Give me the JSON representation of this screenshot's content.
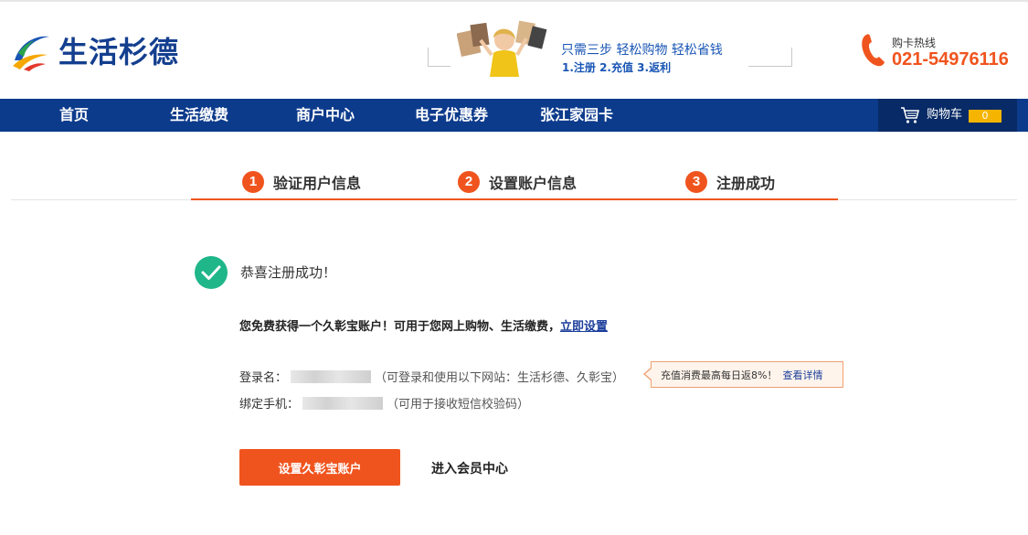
{
  "brand": {
    "name": "生活杉德",
    "colors": {
      "primary_blue": "#0d3b8c",
      "accent_orange": "#f0541e",
      "success_green": "#1fb68a",
      "cart_badge": "#f5b400"
    }
  },
  "promo": {
    "line1": "只需三步  轻松购物  轻松省钱",
    "line2": "1.注册  2.充值  3.返利"
  },
  "hotline": {
    "label": "购卡热线",
    "number": "021-54976116"
  },
  "nav": {
    "items": [
      {
        "label": "首页"
      },
      {
        "label": "生活缴费"
      },
      {
        "label": "商户中心"
      },
      {
        "label": "电子优惠券"
      },
      {
        "label": "张江家园卡"
      }
    ],
    "cart": {
      "label": "购物车",
      "count": "0",
      "icon": "cart-icon"
    }
  },
  "steps": [
    {
      "num": "1",
      "label": "验证用户信息"
    },
    {
      "num": "2",
      "label": "设置账户信息"
    },
    {
      "num": "3",
      "label": "注册成功"
    }
  ],
  "success": {
    "icon": "check-circle-icon",
    "title": "恭喜注册成功！",
    "gift_text": "您免费获得一个久彰宝账户！可用于您网上购物、生活缴费，",
    "gift_link": "立即设置"
  },
  "account": {
    "login_label": "登录名：",
    "login_note": "（可登录和使用以下网站：生活杉德、久彰宝）",
    "phone_label": "绑定手机：",
    "phone_note": "（可用于接收短信校验码）"
  },
  "tip": {
    "text": "充值消费最高每日返8%！",
    "link": "查看详情"
  },
  "actions": {
    "primary": "设置久彰宝账户",
    "secondary": "进入会员中心"
  }
}
